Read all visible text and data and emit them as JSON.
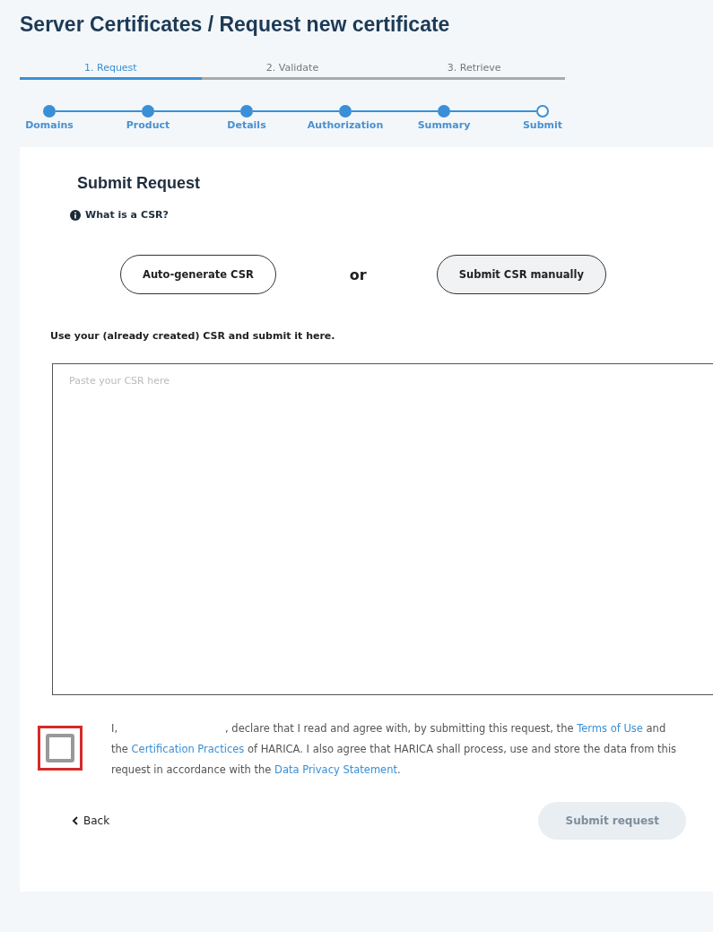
{
  "title": "Server Certificates / Request new certificate",
  "tabs": [
    {
      "label": "1. Request",
      "selected": true
    },
    {
      "label": "2. Validate",
      "selected": false
    },
    {
      "label": "3. Retrieve",
      "selected": false
    }
  ],
  "steps": [
    {
      "label": "Domains",
      "completed": true
    },
    {
      "label": "Product",
      "completed": true
    },
    {
      "label": "Details",
      "completed": true
    },
    {
      "label": "Authorization",
      "completed": true
    },
    {
      "label": "Summary",
      "completed": true
    },
    {
      "label": "Submit",
      "completed": false
    }
  ],
  "card": {
    "heading": "Submit Request",
    "help_link": "What is a CSR?",
    "options": [
      {
        "label": "Auto-generate CSR",
        "selected": false
      },
      {
        "label": "Submit CSR manually",
        "selected": true
      }
    ],
    "or_label": "or",
    "instruction": "Use your (already created) CSR and submit it here.",
    "csr_field": {
      "placeholder": "Paste your CSR here"
    },
    "agreement": {
      "checked": false,
      "highlighted": true,
      "parts": [
        {
          "kind": "text",
          "text": "I,"
        },
        {
          "kind": "blank"
        },
        {
          "kind": "text",
          "text": ", declare that I read and agree with, by submitting this request, the "
        },
        {
          "kind": "link",
          "text": "Terms of Use"
        },
        {
          "kind": "text",
          "text": " and the "
        },
        {
          "kind": "link",
          "text": "Certification Practices"
        },
        {
          "kind": "text",
          "text": " of HARICA. I also agree that HARICA shall process, use and store the data from this request in accordance with the "
        },
        {
          "kind": "link",
          "text": "Data Privacy Statement"
        },
        {
          "kind": "text",
          "text": "."
        }
      ]
    },
    "back": "Back",
    "submit": {
      "label": "Submit request",
      "disabled": true
    }
  }
}
